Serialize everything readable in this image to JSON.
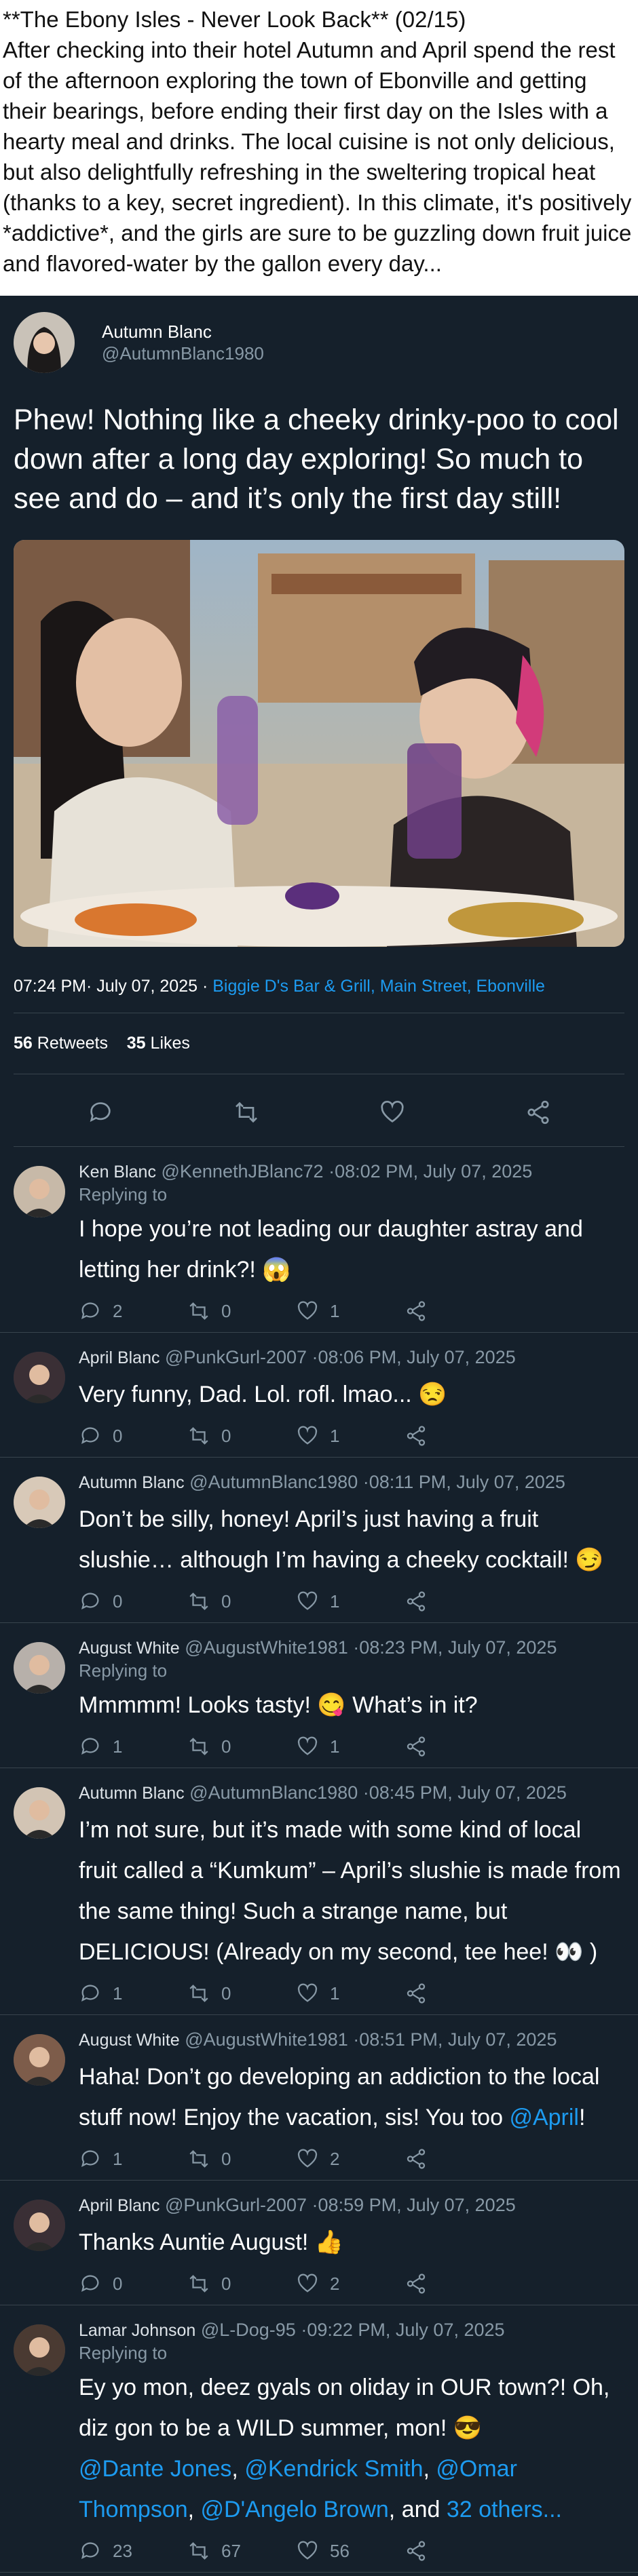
{
  "intro": {
    "title": "**The Ebony Isles - Never Look Back** (02/15)",
    "body": "After checking into their hotel Autumn and April spend the rest of the afternoon exploring the town of Ebonville and getting their bearings, before ending their first day on the Isles with a hearty meal and drinks. The local cuisine is not only delicious, but also delightfully refreshing in the sweltering tropical heat (thanks to a key, secret ingredient). In this climate, it's positively *addictive*, and the girls are sure to be guzzling down fruit juice and flavored-water by the gallon every day..."
  },
  "tweet": {
    "name": "Autumn Blanc",
    "handle": "@AutumnBlanc1980",
    "text": "Phew! Nothing like a cheeky drinky-poo to cool down after a long day exploring! So much to see and do – and it’s only the first day still!",
    "timestamp": "07:24 PM· July 07, 2025 ·",
    "location": "Biggie D's Bar & Grill, Main Street, Ebonville",
    "retweets": "56",
    "retweets_label": "Retweets",
    "likes": "35",
    "likes_label": "Likes"
  },
  "replies": [
    {
      "name": "Ken Blanc",
      "handle": "@KennethJBlanc72",
      "time": "·08:02 PM, July 07, 2025",
      "replying": "Replying to",
      "text": "I hope you’re not leading our daughter astray and letting her drink?! 😱",
      "reply_count": "2",
      "rt_count": "0",
      "like_count": "1"
    },
    {
      "name": "April Blanc",
      "handle": "@PunkGurl-2007",
      "time": "·08:06 PM, July 07, 2025",
      "replying": "",
      "text": "Very funny, Dad. Lol. rofl. lmao... 😒",
      "reply_count": "0",
      "rt_count": "0",
      "like_count": "1"
    },
    {
      "name": "Autumn Blanc",
      "handle": "@AutumnBlanc1980",
      "time": "·08:11 PM, July 07, 2025",
      "replying": "",
      "text": "Don’t be silly, honey! April’s just having a fruit slushie… although I’m having a cheeky cocktail! 😏",
      "reply_count": "0",
      "rt_count": "0",
      "like_count": "1"
    },
    {
      "name": "August White",
      "handle": "@AugustWhite1981",
      "time": "·08:23 PM, July 07, 2025",
      "replying": "Replying to",
      "text": "Mmmmm! Looks tasty! 😋 What’s in it?",
      "reply_count": "1",
      "rt_count": "0",
      "like_count": "1"
    },
    {
      "name": "Autumn Blanc",
      "handle": "@AutumnBlanc1980",
      "time": "·08:45 PM, July 07, 2025",
      "replying": "",
      "text": "I’m not sure, but it’s made with some kind of local fruit called a “Kumkum” – April’s slushie is made from the same thing! Such a strange name, but DELICIOUS! (Already on my second, tee hee! 👀 )",
      "reply_count": "1",
      "rt_count": "0",
      "like_count": "1"
    },
    {
      "name": "August White",
      "handle": "@AugustWhite1981",
      "time": "·08:51 PM, July 07, 2025",
      "replying": "",
      "text": "Haha! Don’t go developing an addiction to the local stuff now! Enjoy the vacation, sis! You too ",
      "mention": "@April",
      "after": "!",
      "reply_count": "1",
      "rt_count": "0",
      "like_count": "2"
    },
    {
      "name": "April Blanc",
      "handle": "@PunkGurl-2007",
      "time": "·08:59 PM, July 07, 2025",
      "replying": "",
      "text": "Thanks Auntie August! 👍",
      "reply_count": "0",
      "rt_count": "0",
      "like_count": "2"
    },
    {
      "name": "Lamar Johnson",
      "handle": "@L-Dog-95",
      "time": "·09:22 PM, July 07, 2025",
      "replying": "Replying to",
      "text": "Ey yo mon, deez gyals on oliday in OUR town?! Oh, diz gon to be a WILD summer, mon! 😎",
      "reply_count": "23",
      "rt_count": "67",
      "like_count": "56"
    }
  ],
  "last_mentions": {
    "m1": "@Dante Jones",
    "sep1": ", ",
    "m2": "@Kendrick Smith",
    "sep2": ", ",
    "m3": "@Omar Thompson",
    "sep3": ", ",
    "m4": "@D'Angelo Brown",
    "sep4": ", and ",
    "m5": "32 others..."
  },
  "colors": {
    "background": "#15202b",
    "accent": "#1d9bf0",
    "muted": "#8899a6"
  },
  "icons": [
    "reply-icon",
    "retweet-icon",
    "like-icon",
    "share-icon"
  ]
}
